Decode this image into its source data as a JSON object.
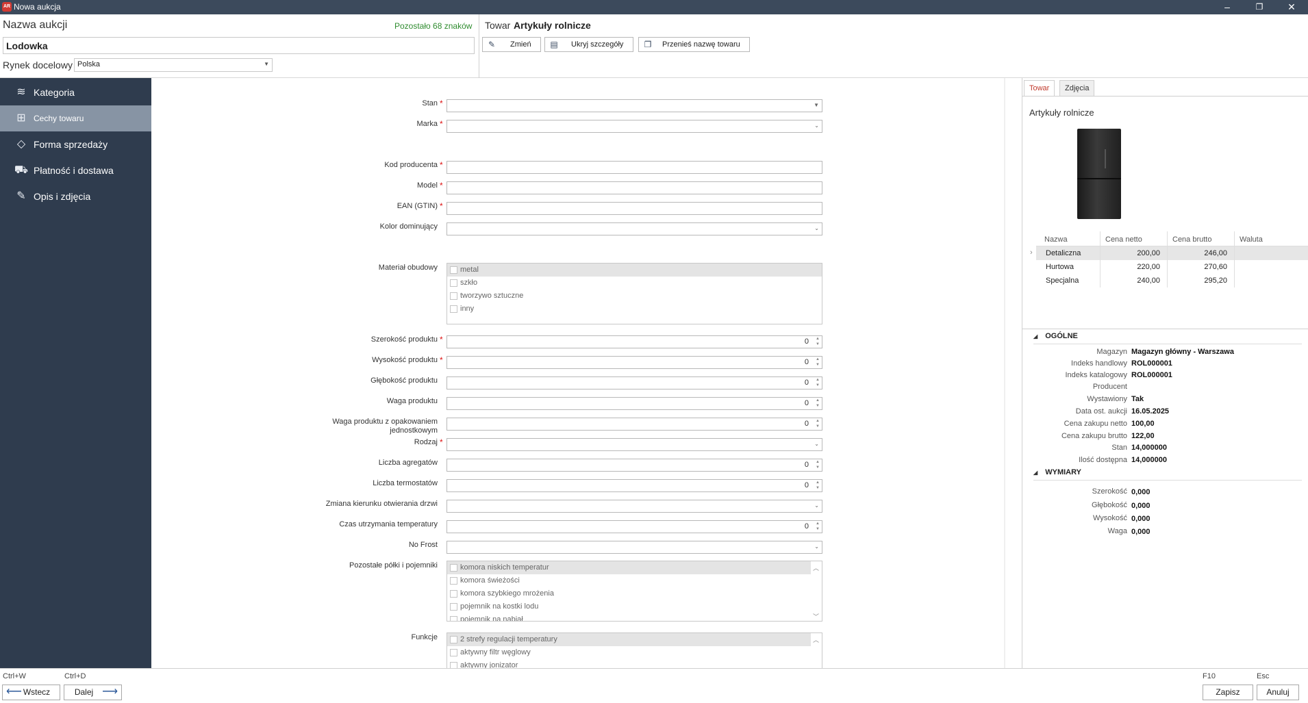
{
  "window": {
    "title": "Nowa aukcja",
    "icon_text": "AR",
    "minimize": "–",
    "restore": "❐",
    "close": "✕"
  },
  "header": {
    "auction_label": "Nazwa aukcji",
    "remaining": "Pozostało 68 znaków",
    "auction_name": "Lodowka",
    "market_label": "Rynek docelowy",
    "market_value": "Polska",
    "product_word": "Towar",
    "product_name": "Artykuły rolnicze",
    "buttons": {
      "change": "Zmień",
      "hide": "Ukryj szczegóły",
      "move": "Przenieś nazwę towaru"
    }
  },
  "sidebar": {
    "items": [
      {
        "label": "Kategoria",
        "icon": "layers-icon"
      },
      {
        "label": "Cechy towaru",
        "icon": "grid-search-icon"
      },
      {
        "label": "Forma sprzedaży",
        "icon": "tag-icon"
      },
      {
        "label": "Płatność i dostawa",
        "icon": "truck-icon"
      },
      {
        "label": "Opis i zdjęcia",
        "icon": "pencil-icon"
      }
    ]
  },
  "form": {
    "stan": "Stan",
    "marka": "Marka",
    "kod": "Kod producenta",
    "model": "Model",
    "ean": "EAN (GTIN)",
    "kolor": "Kolor dominujący",
    "material": "Materiał obudowy",
    "material_options": [
      "metal",
      "szkło",
      "tworzywo sztuczne",
      "inny"
    ],
    "szerokosc": "Szerokość produktu",
    "wysokosc": "Wysokość produktu",
    "glebokosc": "Głębokość produktu",
    "waga": "Waga produktu",
    "waga_opak_1": "Waga produktu z opakowaniem",
    "waga_opak_2": "jednostkowym",
    "rodzaj": "Rodzaj",
    "agregaty": "Liczba agregatów",
    "termostaty": "Liczba termostatów",
    "zmiana": "Zmiana kierunku otwierania drzwi",
    "czas": "Czas utrzymania temperatury",
    "nofrost": "No Frost",
    "polki": "Pozostałe półki i pojemniki",
    "polki_options": [
      "komora niskich temperatur",
      "komora świeżości",
      "komora szybkiego mrożenia",
      "pojemnik na kostki lodu",
      "pojemnik na nabiał"
    ],
    "funkcje": "Funkcje",
    "funkcje_options": [
      "2 strefy regulacji temperatury",
      "aktywny filtr węglowy",
      "aktywny jonizator"
    ],
    "zero": "0"
  },
  "right_panel": {
    "tabs": [
      "Towar",
      "Zdjęcia"
    ],
    "title": "Artykuły rolnicze",
    "price_headers": [
      "Nazwa",
      "Cena netto",
      "Cena brutto",
      "Waluta"
    ],
    "price_rows": [
      {
        "name": "Detaliczna",
        "netto": "200,00",
        "brutto": "246,00"
      },
      {
        "name": "Hurtowa",
        "netto": "220,00",
        "brutto": "270,60"
      },
      {
        "name": "Specjalna",
        "netto": "240,00",
        "brutto": "295,20"
      }
    ],
    "general_title": "OGÓLNE",
    "general": [
      {
        "label": "Magazyn",
        "value": "Magazyn główny - Warszawa"
      },
      {
        "label": "Indeks handlowy",
        "value": "ROL000001"
      },
      {
        "label": "Indeks katalogowy",
        "value": "ROL000001"
      },
      {
        "label": "Producent",
        "value": ""
      },
      {
        "label": "Wystawiony",
        "value": "Tak"
      },
      {
        "label": "Data ost. aukcji",
        "value": "16.05.2025"
      },
      {
        "label": "Cena zakupu netto",
        "value": "100,00"
      },
      {
        "label": "Cena zakupu brutto",
        "value": "122,00"
      },
      {
        "label": "Stan",
        "value": "14,000000"
      },
      {
        "label": "Ilość dostępna",
        "value": "14,000000"
      }
    ],
    "dims_title": "WYMIARY",
    "dims": [
      {
        "label": "Szerokość",
        "value": "0,000"
      },
      {
        "label": "Głębokość",
        "value": "0,000"
      },
      {
        "label": "Wysokość",
        "value": "0,000"
      },
      {
        "label": "Waga",
        "value": "0,000"
      }
    ]
  },
  "footer": {
    "back_shortcut": "Ctrl+W",
    "back_label": "Wstecz",
    "next_shortcut": "Ctrl+D",
    "next_label": "Dalej",
    "save_shortcut": "F10",
    "save_label": "Zapisz",
    "cancel_shortcut": "Esc",
    "cancel_label": "Anuluj"
  }
}
